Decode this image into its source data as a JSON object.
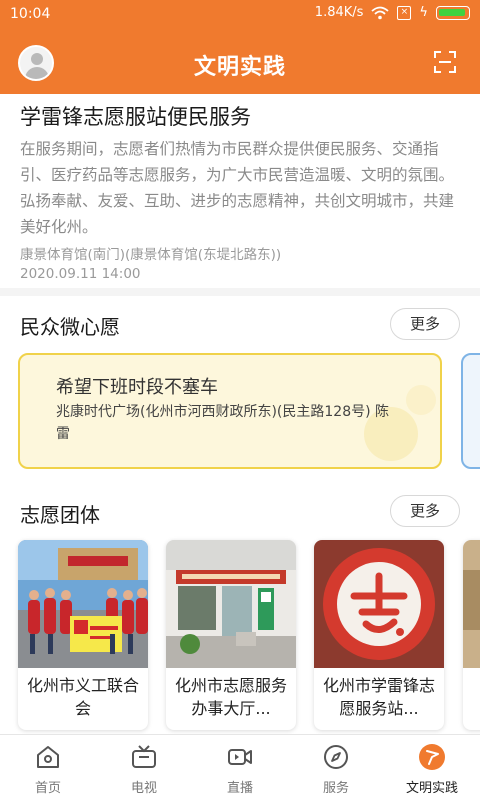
{
  "status_bar": {
    "time": "10:04",
    "speed": "1.84K/s"
  },
  "header": {
    "title": "文明实践"
  },
  "article": {
    "title": "学雷锋志愿服站便民服务",
    "description": "在服务期间，志愿者们热情为市民群众提供便民服务、交通指引、医疗药品等志愿服务，为广大市民营造温暖、文明的氛围。弘扬奉献、友爱、互助、进步的志愿精神，共创文明城市，共建美好化州。",
    "location": "康景体育馆(南门)(康景体育馆(东堤北路东))",
    "date": "2020.09.11 14:00"
  },
  "wishes": {
    "title": "民众微心愿",
    "more": "更多",
    "card": {
      "title": "希望下班时段不塞车",
      "address": "兆康时代广场(化州市河西财政所东)(民主路128号) 陈雷"
    }
  },
  "teams": {
    "title": "志愿团体",
    "more": "更多",
    "items": [
      {
        "name": "化州市义工联合会"
      },
      {
        "name": "化州市志愿服务办事大厅..."
      },
      {
        "name": "化州市学雷锋志愿服务站..."
      }
    ]
  },
  "nav": {
    "items": [
      {
        "label": "首页",
        "icon": "home-icon"
      },
      {
        "label": "电视",
        "icon": "tv-icon"
      },
      {
        "label": "直播",
        "icon": "live-icon"
      },
      {
        "label": "服务",
        "icon": "compass-icon"
      },
      {
        "label": "文明实践",
        "icon": "flag-icon"
      }
    ]
  },
  "colors": {
    "accent": "#f07a2e",
    "wish_border": "#f0d24a",
    "wish_bg": "#fdf7dc"
  }
}
